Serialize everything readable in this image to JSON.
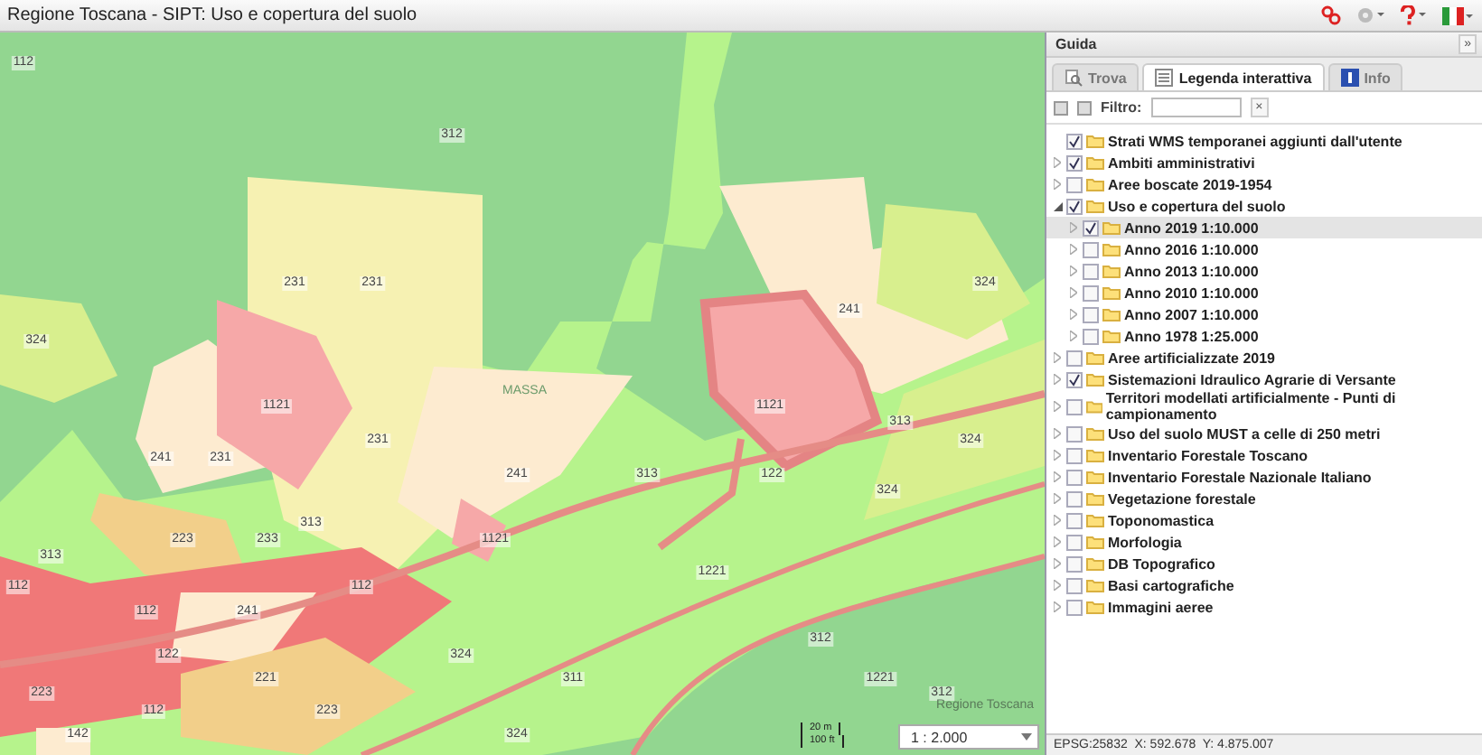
{
  "window": {
    "title": "Regione Toscana - SIPT: Uso e copertura del suolo"
  },
  "panel": {
    "title": "Guida",
    "collapse": "»"
  },
  "tabs": [
    {
      "label": "Trova",
      "selected": false,
      "kind": "search"
    },
    {
      "label": "Legenda interattiva",
      "selected": true,
      "kind": "legend"
    },
    {
      "label": "Info",
      "selected": false,
      "kind": "info"
    }
  ],
  "filter": {
    "label": "Filtro:",
    "clear": "×"
  },
  "tree": [
    {
      "label": "Strati WMS temporanei aggiunti dall'utente",
      "kind": "layer",
      "checked": true,
      "selected": false
    },
    {
      "label": "Ambiti amministrativi",
      "kind": "group",
      "checked": true,
      "selected": false
    },
    {
      "label": "Aree boscate 2019-1954",
      "kind": "group",
      "checked": false,
      "selected": false
    },
    {
      "label": "Uso e copertura del suolo",
      "kind": "group",
      "checked": true,
      "selected": false,
      "expanded": true,
      "children": [
        {
          "label": "Anno 2019 1:10.000",
          "kind": "group",
          "checked": true,
          "selected": true
        },
        {
          "label": "Anno 2016 1:10.000",
          "kind": "group",
          "checked": false,
          "selected": false
        },
        {
          "label": "Anno 2013 1:10.000",
          "kind": "group",
          "checked": false,
          "selected": false
        },
        {
          "label": "Anno 2010 1:10.000",
          "kind": "group",
          "checked": false,
          "selected": false
        },
        {
          "label": "Anno 2007 1:10.000",
          "kind": "group",
          "checked": false,
          "selected": false
        },
        {
          "label": "Anno 1978 1:25.000",
          "kind": "group",
          "checked": false,
          "selected": false
        }
      ]
    },
    {
      "label": "Aree artificializzate 2019",
      "kind": "group",
      "checked": false,
      "selected": false
    },
    {
      "label": "Sistemazioni Idraulico Agrarie di Versante",
      "kind": "group",
      "checked": true,
      "selected": false
    },
    {
      "label": "Territori modellati artificialmente - Punti di campionamento",
      "kind": "group",
      "checked": false,
      "selected": false
    },
    {
      "label": "Uso del suolo MUST a celle di 250 metri",
      "kind": "group",
      "checked": false,
      "selected": false
    },
    {
      "label": "Inventario Forestale Toscano",
      "kind": "group",
      "checked": false,
      "selected": false
    },
    {
      "label": "Inventario Forestale Nazionale Italiano",
      "kind": "group",
      "checked": false,
      "selected": false
    },
    {
      "label": "Vegetazione forestale",
      "kind": "group",
      "checked": false,
      "selected": false
    },
    {
      "label": "Toponomastica",
      "kind": "group",
      "checked": false,
      "selected": false
    },
    {
      "label": "Morfologia",
      "kind": "group",
      "checked": false,
      "selected": false
    },
    {
      "label": "DB Topografico",
      "kind": "group",
      "checked": false,
      "selected": false
    },
    {
      "label": "Basi cartografiche",
      "kind": "group",
      "checked": false,
      "selected": false
    },
    {
      "label": "Immagini aeree",
      "kind": "group",
      "checked": false,
      "selected": false
    }
  ],
  "map": {
    "labels": [
      "112",
      "312",
      "231",
      "231",
      "324",
      "241",
      "324",
      "1121",
      "1121",
      "313",
      "231",
      "324",
      "241",
      "231",
      "241",
      "313",
      "122",
      "324",
      "313",
      "223",
      "233",
      "1121",
      "313",
      "1221",
      "112",
      "112",
      "112",
      "241",
      "312",
      "122",
      "324",
      "221",
      "311",
      "1221",
      "223",
      "312",
      "112",
      "223",
      "142",
      "324"
    ],
    "place": "MASSA",
    "attribution": "Regione Toscana",
    "scale_top": "20 m",
    "scale_bottom": "100 ft",
    "scale": "1 : 2.000"
  },
  "status_bar": "EPSG:25832  X: 592.678  Y: 4.875.007"
}
